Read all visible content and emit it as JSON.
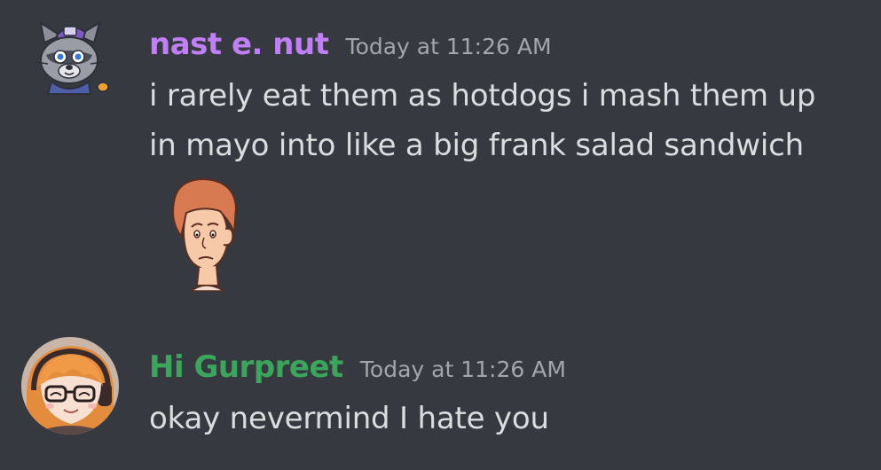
{
  "colors": {
    "background": "#36393f",
    "text": "#dcddde",
    "timestamp": "#a3a6aa",
    "user1": "#c17ff5",
    "user2": "#3ba55c"
  },
  "messages": [
    {
      "username": "nast e. nut",
      "timestamp": "Today at 11:26 AM",
      "lines": [
        "i rarely eat them as hotdogs i mash them up",
        "in mayo into like a big frank salad sandwich"
      ],
      "avatar_icon": "raccoon-cartoon-avatar",
      "attachment_icon": "sad-man-sticker"
    },
    {
      "username": "Hi Gurpreet",
      "timestamp": "Today at 11:26 AM",
      "lines": [
        "okay nevermind I hate you"
      ],
      "avatar_icon": "anime-girl-glasses-avatar"
    }
  ]
}
